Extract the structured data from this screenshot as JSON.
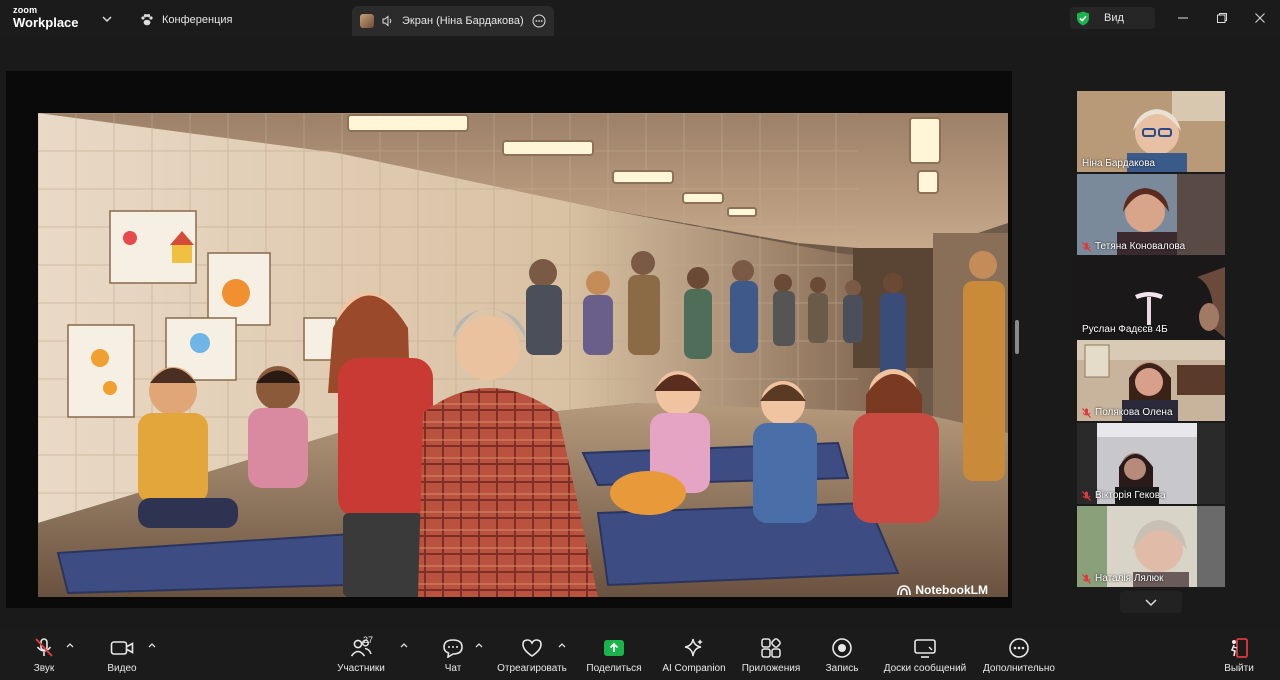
{
  "app": {
    "logo_top": "zoom",
    "logo_bottom": "Workplace",
    "meeting_tab": "Конференция",
    "share_tab": "Экран (Ніна Бардакова)",
    "view_label": "Вид"
  },
  "share": {
    "watermark": "NotebookLM"
  },
  "participants": [
    {
      "name": "Ніна Бардакова",
      "muted": false,
      "active": false
    },
    {
      "name": "Тетяна Коновалова",
      "muted": true,
      "active": false
    },
    {
      "name": "Руслан Фадєєв 4Б",
      "muted": false,
      "active": true
    },
    {
      "name": "Полякова Олена",
      "muted": true,
      "active": false
    },
    {
      "name": "Вікторія Гекова",
      "muted": true,
      "active": false
    },
    {
      "name": "Наталія Лялюк",
      "muted": true,
      "active": false
    }
  ],
  "toolbar": {
    "audio": "Звук",
    "video": "Видео",
    "participants": "Участники",
    "participants_count": "27",
    "chat": "Чат",
    "react": "Отреагировать",
    "share": "Поделиться",
    "ai": "AI Companion",
    "apps": "Приложения",
    "record": "Запись",
    "whiteboards": "Доски сообщений",
    "more": "Дополнительно",
    "leave": "Выйти"
  },
  "colors": {
    "active_speaker": "#29d97b",
    "share_green": "#19b44a",
    "leave_red": "#e0383e",
    "muted_red": "#e0383e",
    "shield_green": "#19b44a"
  }
}
